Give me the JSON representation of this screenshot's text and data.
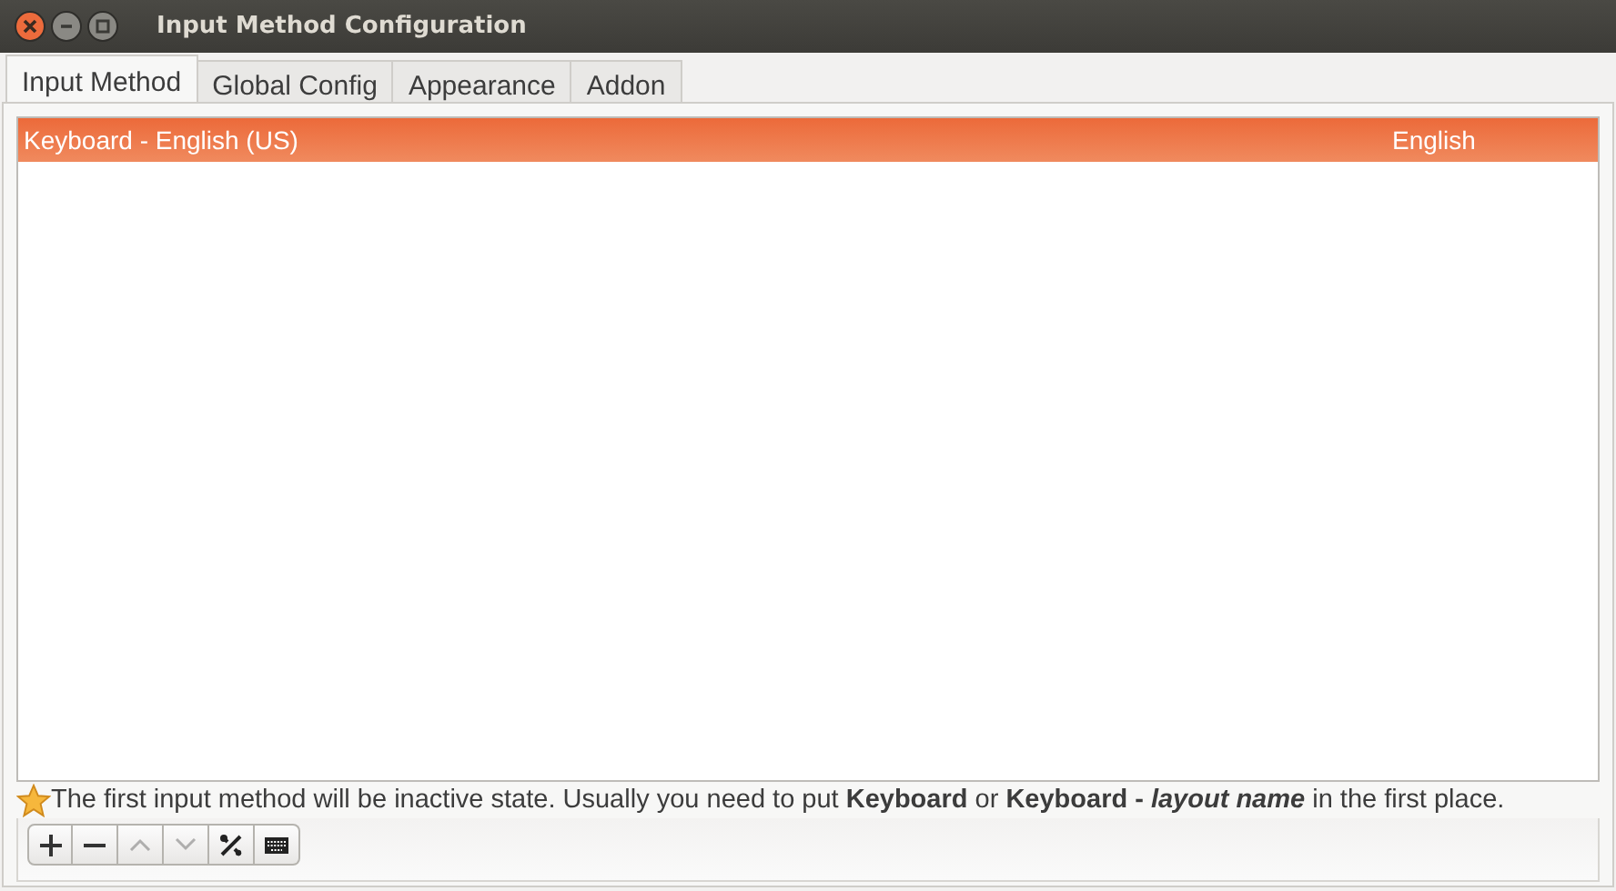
{
  "window": {
    "title": "Input Method Configuration"
  },
  "tabs": [
    {
      "label": "Input Method",
      "selected": true
    },
    {
      "label": "Global Config",
      "selected": false
    },
    {
      "label": "Appearance",
      "selected": false
    },
    {
      "label": "Addon",
      "selected": false
    }
  ],
  "input_methods": [
    {
      "name": "Keyboard - English (US)",
      "language": "English",
      "selected": true
    }
  ],
  "hint": "The first input method will be inactive state. Usually you need to put **Keyboard** or **Keyboard -** *layout name* in the first place.",
  "toolbar": [
    {
      "kind": "add",
      "disabled": false
    },
    {
      "kind": "remove",
      "disabled": false
    },
    {
      "kind": "up",
      "disabled": true
    },
    {
      "kind": "down",
      "disabled": true
    },
    {
      "kind": "configure",
      "disabled": false
    },
    {
      "kind": "keyboard",
      "disabled": false
    }
  ]
}
